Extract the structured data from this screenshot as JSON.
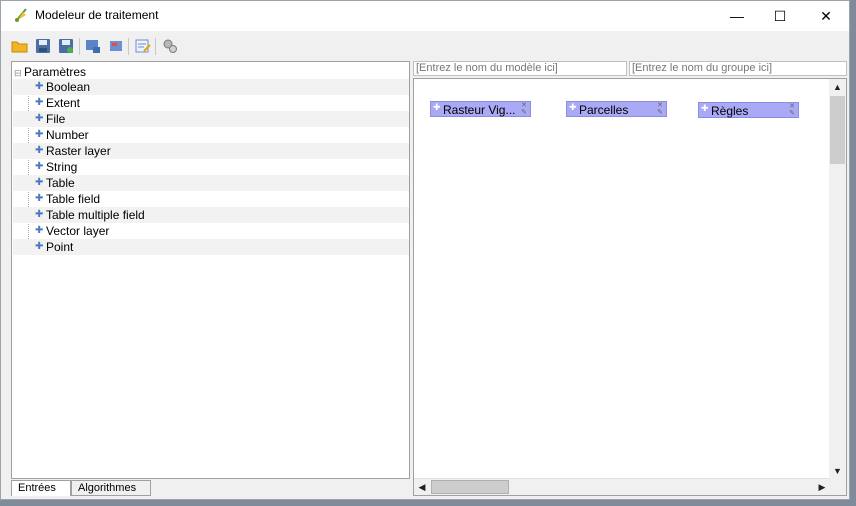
{
  "window": {
    "title": "Modeleur de traitement",
    "icon": "qgis-logo-icon",
    "controls": {
      "minimize": "—",
      "maximize": "☐",
      "close": "✕"
    }
  },
  "toolbar": {
    "buttons": [
      {
        "name": "open-model-button",
        "icon": "folder-icon"
      },
      {
        "name": "save-model-button",
        "icon": "save-icon"
      },
      {
        "name": "save-as-model-button",
        "icon": "save-as-icon"
      },
      {
        "name": "export-image-button",
        "icon": "export-image-icon"
      },
      {
        "name": "export-python-button",
        "icon": "export-script-icon"
      },
      {
        "name": "edit-help-button",
        "icon": "edit-help-icon"
      },
      {
        "name": "run-model-button",
        "icon": "gears-icon"
      }
    ]
  },
  "inputs_tree": {
    "root_label": "Paramètres",
    "items": [
      {
        "label": "Boolean"
      },
      {
        "label": "Extent"
      },
      {
        "label": "File"
      },
      {
        "label": "Number"
      },
      {
        "label": "Raster layer"
      },
      {
        "label": "String"
      },
      {
        "label": "Table"
      },
      {
        "label": "Table field"
      },
      {
        "label": "Table multiple field"
      },
      {
        "label": "Vector layer"
      },
      {
        "label": "Point"
      }
    ]
  },
  "tabs": [
    {
      "label": "Entrées",
      "active": true
    },
    {
      "label": "Algorithmes",
      "active": false
    }
  ],
  "model_name": {
    "placeholder": "[Entrez le nom du modèle ici]"
  },
  "group_name": {
    "placeholder": "[Entrez le nom du groupe ici]"
  },
  "canvas": {
    "nodes": [
      {
        "label": "Rasteur Vig..."
      },
      {
        "label": "Parcelles"
      },
      {
        "label": "Règles"
      }
    ],
    "node_color": "#a9a9f5"
  },
  "colors": {
    "accent": "#4a79c2",
    "node_fill": "#a9a9f5"
  }
}
